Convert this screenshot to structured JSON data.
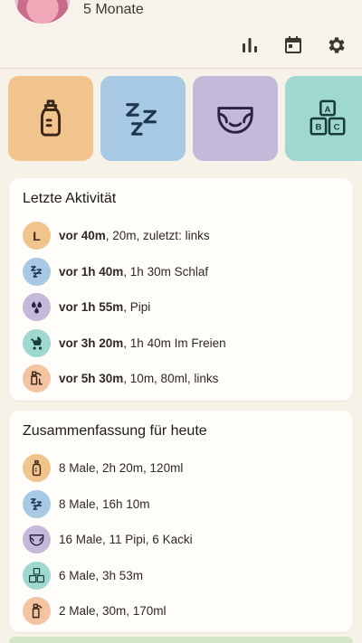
{
  "header": {
    "age": "5 Monate"
  },
  "toolbar": {
    "icons": [
      "bar-chart-icon",
      "calendar-icon",
      "gear-icon"
    ]
  },
  "tiles": [
    {
      "name": "feeding-tile",
      "icon": "bottle-icon",
      "color": "#f1c48d"
    },
    {
      "name": "sleep-tile",
      "icon": "zzz-icon",
      "color": "#a7c9e3"
    },
    {
      "name": "diaper-tile",
      "icon": "diaper-icon",
      "color": "#c4b9d9"
    },
    {
      "name": "activity-tile",
      "icon": "abc-blocks-icon",
      "color": "#9ed8d0"
    }
  ],
  "last_activity": {
    "title": "Letzte Aktivität",
    "items": [
      {
        "icon": "L",
        "bold": "vor 40m",
        "rest": ", 20m, zuletzt: links",
        "color": "#f1c48d"
      },
      {
        "icon": "zzz-icon",
        "bold": "vor 1h 40m",
        "rest": ", 1h 30m Schlaf",
        "color": "#a7c9e3"
      },
      {
        "icon": "drops-icon",
        "bold": "vor 1h 55m",
        "rest": ", Pipi",
        "color": "#c4b9d9"
      },
      {
        "icon": "stroller-icon",
        "bold": "vor 3h 20m",
        "rest": ", 1h 40m Im Freien",
        "color": "#9ed8d0"
      },
      {
        "icon": "pump-icon",
        "bold": "vor 5h 30m",
        "rest": ", 10m, 80ml, links",
        "color": "#f4c4a2"
      }
    ]
  },
  "summary": {
    "title": "Zusammenfassung für heute",
    "items": [
      {
        "icon": "bottle-icon",
        "text": "8 Male, 2h 20m, 120ml",
        "color": "#f1c48d"
      },
      {
        "icon": "zzz-icon",
        "text": "8 Male, 16h 10m",
        "color": "#a7c9e3"
      },
      {
        "icon": "diaper-icon",
        "text": "16 Male, 11 Pipi, 6 Kacki",
        "color": "#c4b9d9"
      },
      {
        "icon": "abc-blocks-icon",
        "text": "6 Male, 3h 53m",
        "color": "#9ed8d0"
      },
      {
        "icon": "pump-icon",
        "text": "2 Male, 30m, 170ml",
        "color": "#f4c4a2"
      }
    ]
  }
}
